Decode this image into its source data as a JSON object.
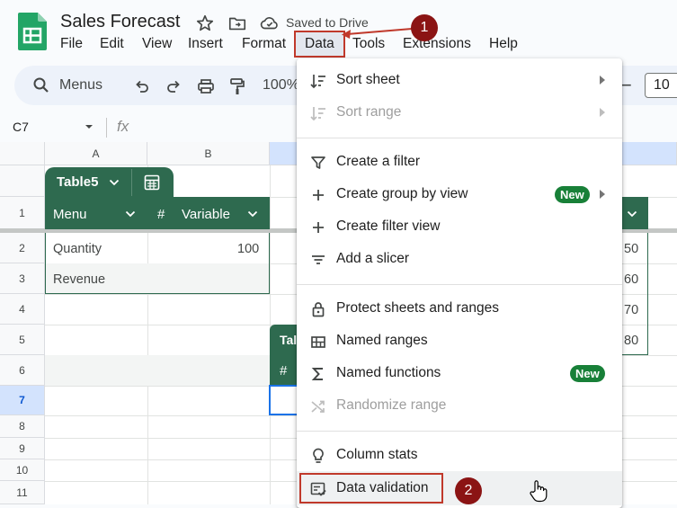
{
  "app": {
    "title": "Sales Forecast",
    "save_status": "Saved to Drive"
  },
  "menubar": {
    "items": [
      "File",
      "Edit",
      "View",
      "Insert",
      "Format",
      "Data",
      "Tools",
      "Extensions",
      "Help"
    ],
    "active": "Data"
  },
  "toolbar": {
    "search_label": "Menus",
    "zoom": "100%",
    "font_size": "10"
  },
  "formula_bar": {
    "cell_ref": "C7",
    "fx": "fx"
  },
  "grid": {
    "columns": [
      "A",
      "B"
    ],
    "rows": [
      "1",
      "2",
      "3",
      "4",
      "5",
      "6",
      "7",
      "8",
      "9",
      "10",
      "11"
    ],
    "selected_row": "7"
  },
  "table": {
    "name": "Table5",
    "columns": [
      {
        "label": "Menu",
        "type_icon": ""
      },
      {
        "label": "Variable",
        "type_icon": "#"
      }
    ],
    "rows": [
      {
        "menu": "Quantity",
        "variable": "100"
      },
      {
        "menu": "Revenue",
        "variable": ""
      }
    ]
  },
  "table2": {
    "label": "Tal",
    "col_icon": "#"
  },
  "right_table": {
    "values": [
      "50",
      "60",
      "70",
      "80"
    ]
  },
  "data_menu": {
    "groups": [
      [
        {
          "label": "Sort sheet",
          "icon": "sort-icon",
          "submenu": true,
          "disabled": false
        },
        {
          "label": "Sort range",
          "icon": "sort-icon",
          "submenu": true,
          "disabled": true
        }
      ],
      [
        {
          "label": "Create a filter",
          "icon": "filter-icon",
          "submenu": false,
          "disabled": false
        },
        {
          "label": "Create group by view",
          "icon": "plus-icon",
          "submenu": true,
          "disabled": false,
          "badge": "New"
        },
        {
          "label": "Create filter view",
          "icon": "plus-icon",
          "submenu": false,
          "disabled": false
        },
        {
          "label": "Add a slicer",
          "icon": "slicer-icon",
          "submenu": false,
          "disabled": false
        }
      ],
      [
        {
          "label": "Protect sheets and ranges",
          "icon": "lock-icon",
          "submenu": false,
          "disabled": false
        },
        {
          "label": "Named ranges",
          "icon": "named-ranges-icon",
          "submenu": false,
          "disabled": false
        },
        {
          "label": "Named functions",
          "icon": "sigma-icon",
          "submenu": false,
          "disabled": false,
          "badge": "New"
        },
        {
          "label": "Randomize range",
          "icon": "shuffle-icon",
          "submenu": false,
          "disabled": true
        }
      ],
      [
        {
          "label": "Column stats",
          "icon": "lightbulb-icon",
          "submenu": false,
          "disabled": false
        },
        {
          "label": "Data validation",
          "icon": "data-validation-icon",
          "submenu": false,
          "disabled": false,
          "highlighted": true
        }
      ]
    ]
  },
  "annotations": {
    "step1": "1",
    "step2": "2",
    "color": "#8b1414",
    "box_color": "#c0392b"
  },
  "colors": {
    "table_header": "#2e6a4f",
    "badge_green": "#188038",
    "selection_blue": "#1a73e8"
  }
}
